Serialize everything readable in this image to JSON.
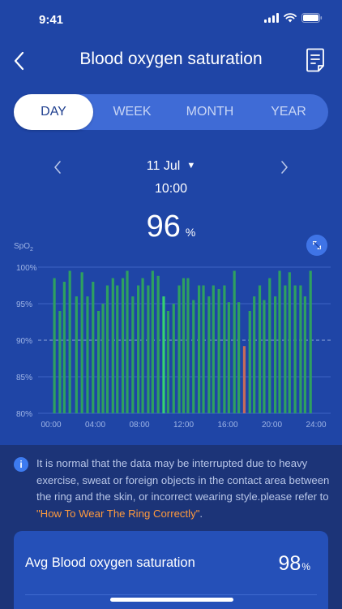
{
  "status_bar": {
    "time": "9:41"
  },
  "header": {
    "title": "Blood oxygen saturation"
  },
  "tabs": [
    {
      "label": "DAY",
      "active": true
    },
    {
      "label": "WEEK",
      "active": false
    },
    {
      "label": "MONTH",
      "active": false
    },
    {
      "label": "YEAR",
      "active": false
    }
  ],
  "date": {
    "label": "11 Jul",
    "time": "10:00"
  },
  "reading": {
    "value": "96",
    "unit": "%"
  },
  "chart_data": {
    "type": "bar",
    "ylabel": "SpO",
    "ylabel_subscript": "2",
    "ylim": [
      80,
      100
    ],
    "ytick_labels": [
      "100%",
      "95%",
      "90%",
      "85%",
      "80%"
    ],
    "yticks": [
      100,
      95,
      90,
      85,
      80
    ],
    "x_range": [
      0,
      24
    ],
    "xtick_labels": [
      "00:00",
      "04:00",
      "08:00",
      "12:00",
      "16:00",
      "20:00",
      "24:00"
    ],
    "xticks": [
      0,
      4,
      8,
      12,
      16,
      20,
      24
    ],
    "reference_line": 90,
    "grid": true,
    "colors": {
      "normal": "#2ea060",
      "selected": "#34d270",
      "low": "#c46a5a"
    },
    "bars": [
      {
        "x": 0.3,
        "y": 98.5
      },
      {
        "x": 0.8,
        "y": 94
      },
      {
        "x": 1.2,
        "y": 98
      },
      {
        "x": 1.7,
        "y": 99.5
      },
      {
        "x": 2.3,
        "y": 96
      },
      {
        "x": 2.8,
        "y": 99.3
      },
      {
        "x": 3.3,
        "y": 96
      },
      {
        "x": 3.8,
        "y": 98
      },
      {
        "x": 4.3,
        "y": 94
      },
      {
        "x": 4.7,
        "y": 95
      },
      {
        "x": 5.1,
        "y": 97.5
      },
      {
        "x": 5.6,
        "y": 98.5
      },
      {
        "x": 6.0,
        "y": 97.5
      },
      {
        "x": 6.5,
        "y": 98.5
      },
      {
        "x": 6.9,
        "y": 99.5
      },
      {
        "x": 7.4,
        "y": 96
      },
      {
        "x": 7.9,
        "y": 97.5
      },
      {
        "x": 8.3,
        "y": 98.5
      },
      {
        "x": 8.8,
        "y": 97.5
      },
      {
        "x": 9.2,
        "y": 99.5
      },
      {
        "x": 9.7,
        "y": 98.8
      },
      {
        "x": 10.2,
        "y": 96,
        "state": "selected"
      },
      {
        "x": 10.6,
        "y": 94
      },
      {
        "x": 11.1,
        "y": 95
      },
      {
        "x": 11.6,
        "y": 97.5
      },
      {
        "x": 12.0,
        "y": 98.5
      },
      {
        "x": 12.4,
        "y": 98.5
      },
      {
        "x": 12.9,
        "y": 95.5
      },
      {
        "x": 13.4,
        "y": 97.5
      },
      {
        "x": 13.8,
        "y": 97.5
      },
      {
        "x": 14.3,
        "y": 96
      },
      {
        "x": 14.7,
        "y": 97.5
      },
      {
        "x": 15.2,
        "y": 97
      },
      {
        "x": 15.7,
        "y": 97.5
      },
      {
        "x": 16.1,
        "y": 95.2
      },
      {
        "x": 16.6,
        "y": 99.5
      },
      {
        "x": 17.0,
        "y": 95.2
      },
      {
        "x": 17.5,
        "y": 89.2,
        "state": "low"
      },
      {
        "x": 18.0,
        "y": 94
      },
      {
        "x": 18.4,
        "y": 96
      },
      {
        "x": 18.9,
        "y": 97.5
      },
      {
        "x": 19.3,
        "y": 95.5
      },
      {
        "x": 19.8,
        "y": 98.5
      },
      {
        "x": 20.3,
        "y": 96
      },
      {
        "x": 20.7,
        "y": 99.5
      },
      {
        "x": 21.2,
        "y": 97.5
      },
      {
        "x": 21.6,
        "y": 99.3
      },
      {
        "x": 22.1,
        "y": 97.5
      },
      {
        "x": 22.6,
        "y": 97.5
      },
      {
        "x": 23.0,
        "y": 96
      },
      {
        "x": 23.5,
        "y": 99.5
      }
    ]
  },
  "info": {
    "text": "It is normal that the data may be interrupted due to heavy exercise, sweat or foreign objects in the contact area between the ring and the skin, or incorrect wearing style.please refer to ",
    "link_text": "\"How To Wear The Ring Correctly\"",
    "suffix": "."
  },
  "summary": {
    "label": "Avg Blood oxygen saturation",
    "value": "98",
    "unit": "%"
  }
}
